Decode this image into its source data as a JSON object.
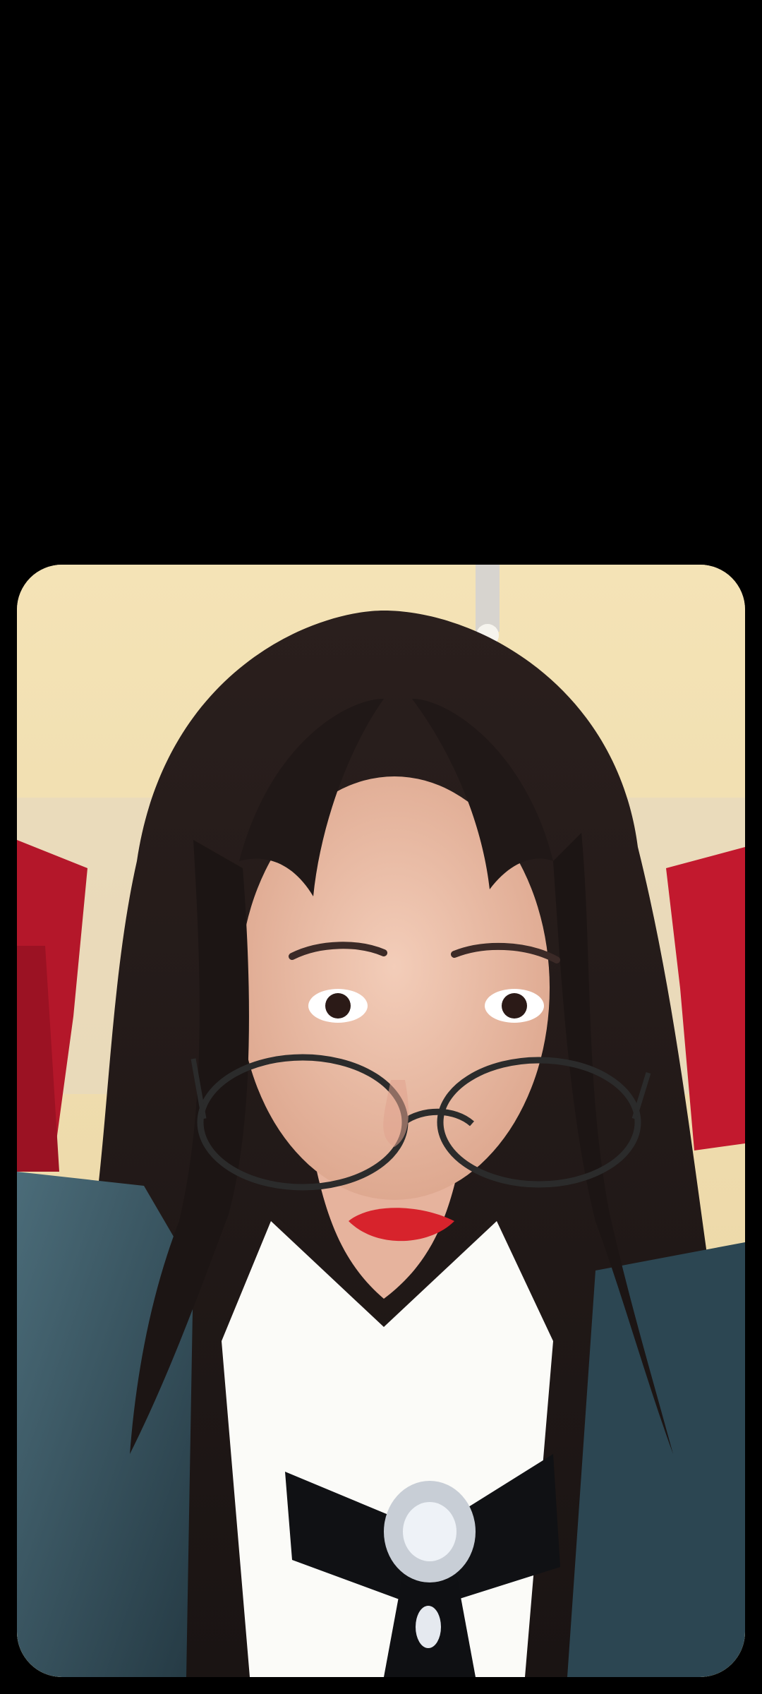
{
  "viewer": {
    "background_color": "#000000",
    "photo": {
      "subject": "selfie-portrait",
      "icon": "photo-preview"
    }
  }
}
